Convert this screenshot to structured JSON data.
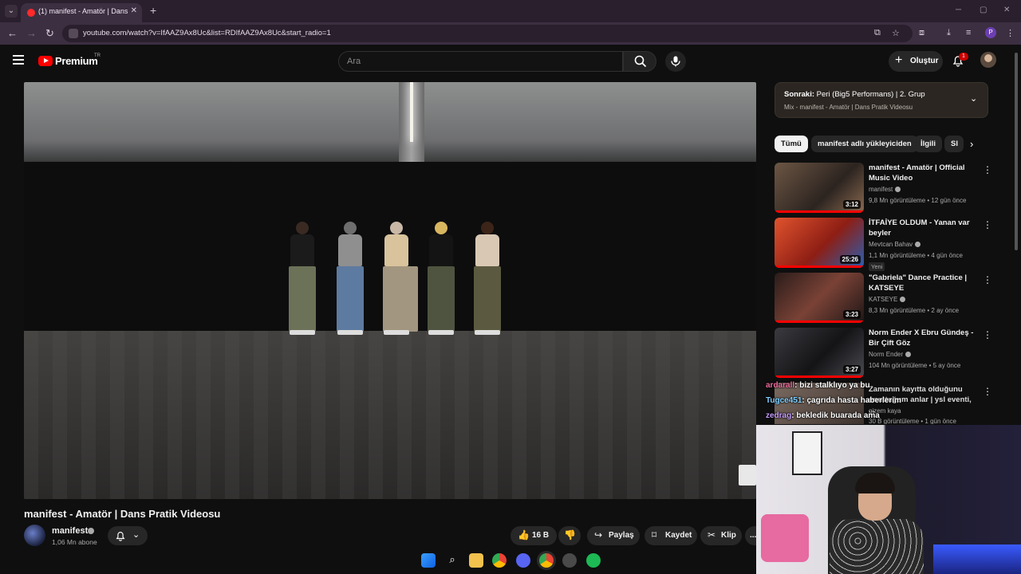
{
  "browser": {
    "tab_title": "(1) manifest - Amatör | Dans Pr...",
    "url": "youtube.com/watch?v=IfAAZ9Ax8Uc&list=RDIfAAZ9Ax8Uc&start_radio=1",
    "profile_initial": "P"
  },
  "header": {
    "logo_text": "Premium",
    "country": "TR",
    "search_placeholder": "Ara",
    "create_label": "Oluştur",
    "notification_count": "1"
  },
  "video": {
    "title": "manifest - Amatör | Dans Pratik Videosu",
    "channel": "manifest",
    "subscribers": "1,06 Mn abone",
    "likes": "16 B",
    "share_label": "Paylaş",
    "save_label": "Kaydet",
    "clip_label": "Klip",
    "more_label": "..."
  },
  "next_up": {
    "prefix": "Sonraki:",
    "title": "Peri (Big5 Performans) | 2. Grup",
    "subtitle": "Mix - manifest - Amatör | Dans Pratik Videosu"
  },
  "chips": [
    "Tümü",
    "manifest adlı yükleyiciden",
    "İlgili",
    "Sl"
  ],
  "recommendations": [
    {
      "title": "manifest - Amatör | Official Music Video",
      "channel": "manifest",
      "meta": "9,8 Mn görüntüleme • 12 gün önce",
      "duration": "3:12",
      "badge": "",
      "thumb": "#5c4a3a"
    },
    {
      "title": "İTFAİYE OLDUM - Yanan var beyler",
      "channel": "Mevtcan Bahav",
      "meta": "1,1 Mn görüntüleme • 4 gün önce",
      "duration": "25:26",
      "badge": "Yeni",
      "thumb": "#b23a2a"
    },
    {
      "title": "\"Gabriela\" Dance Practice | KATSEYE",
      "channel": "KATSEYE",
      "meta": "8,3 Mn görüntüleme • 2 ay önce",
      "duration": "3:23",
      "badge": "",
      "thumb": "#4a2a24"
    },
    {
      "title": "Norm Ender X Ebru Gündeş - Bir Çift Göz",
      "channel": "Norm Ender",
      "meta": "104 Mn görüntüleme • 5 ay önce",
      "duration": "3:27",
      "badge": "",
      "thumb": "#2a2a2e"
    },
    {
      "title": "Zamanın kayıtta olduğunu unuttuğum anlar | ysl eventi, ...",
      "channel": "gizem kaya",
      "meta": "30 B görüntüleme • 1 gün önce",
      "duration": "",
      "badge": "",
      "thumb": "#6a5a52"
    }
  ],
  "chat": [
    {
      "user": "ardarall",
      "message": ": bizi stalklıyo ya bu"
    },
    {
      "user": "Tugce451",
      "message": ": çagrıda hasta haberlerim"
    },
    {
      "user": "zedrag",
      "message": ": bekledik buarada ama"
    }
  ],
  "colors": {
    "accent": "#ff0000",
    "background": "#0f0f0f",
    "chrome": "#3c2f41"
  }
}
